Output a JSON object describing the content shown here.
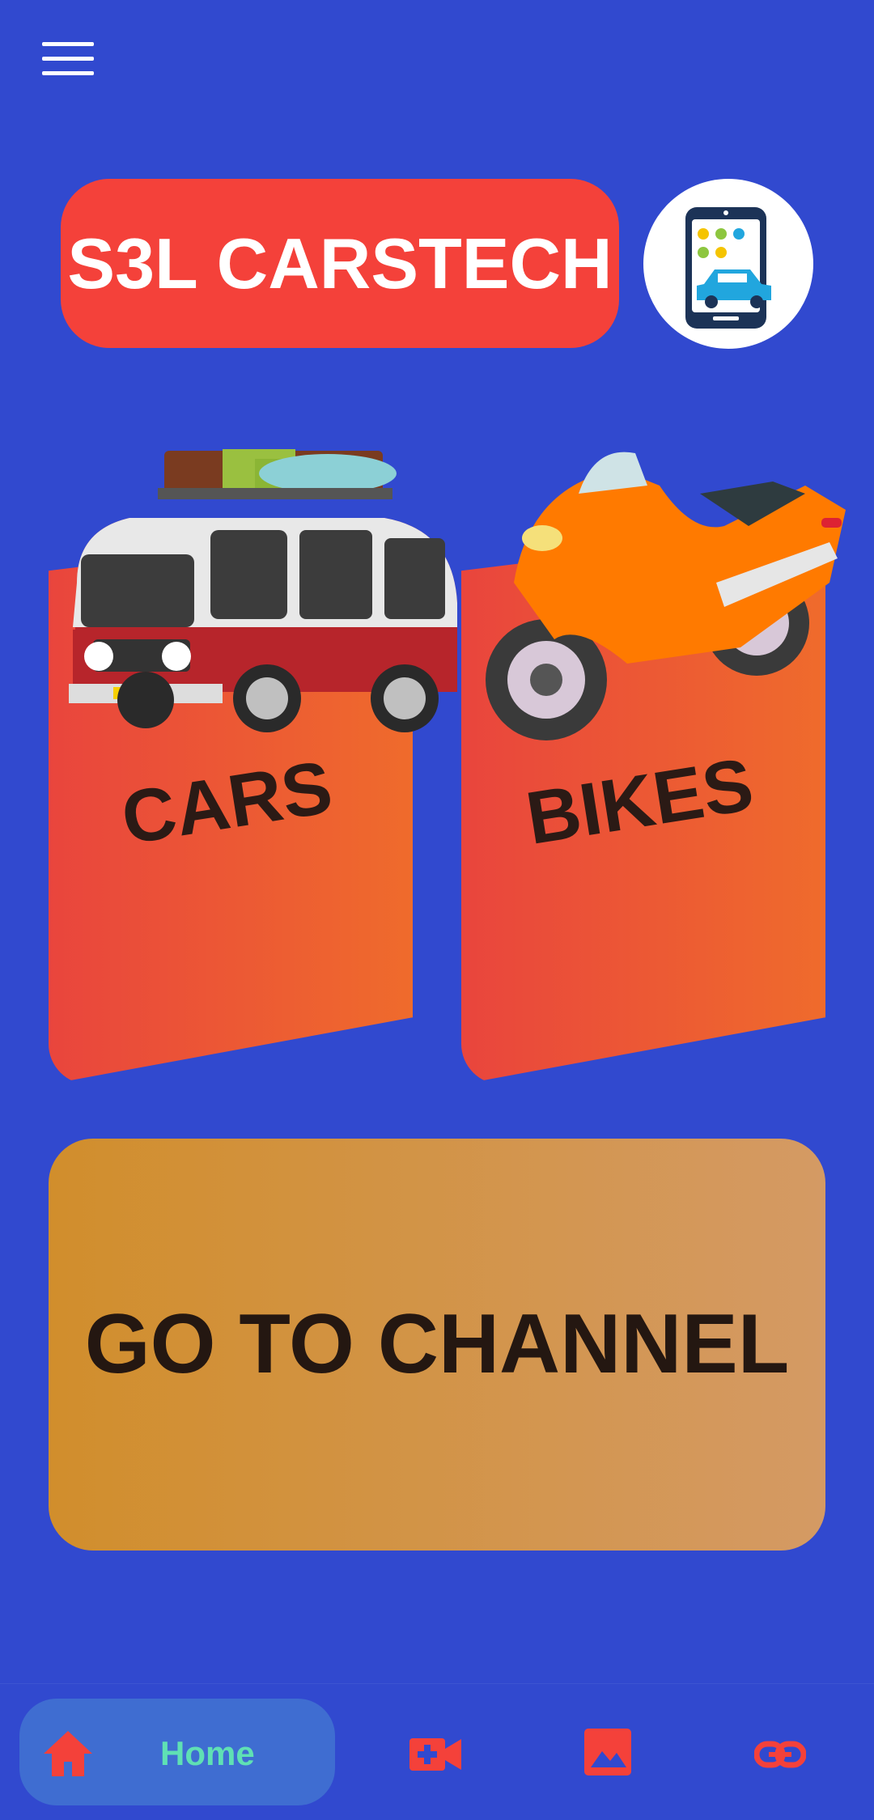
{
  "app": {
    "title": "S3L CARSTECH"
  },
  "cards": {
    "cars_label": "CARS",
    "bikes_label": "BIKES"
  },
  "channel_button": {
    "label": "GO TO CHANNEL"
  },
  "bottom_nav": {
    "items": [
      {
        "label": "Home",
        "icon": "home-icon",
        "selected": true
      },
      {
        "icon": "video-add-icon"
      },
      {
        "icon": "image-icon"
      },
      {
        "icon": "link-icon"
      }
    ]
  },
  "colors": {
    "background": "#3149cf",
    "title_pill": "#f4413a",
    "card_gradient_start": "#e9453d",
    "card_gradient_end": "#ef6b2c",
    "channel_gradient_start": "#d18e2c",
    "channel_gradient_end": "#d49a64",
    "nav_active_bg": "#3f6dd1",
    "nav_active_text": "#5fe0b4",
    "nav_icon": "#f4413a"
  }
}
